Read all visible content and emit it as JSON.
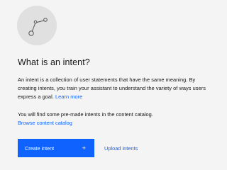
{
  "illustration": {
    "icon": "intent-nodes-icon",
    "circle_color": "#e0e0e0",
    "line_color": "#525252"
  },
  "heading": "What is an intent?",
  "description": {
    "text": "An intent is a collection of user statements that have the same meaning. By creating intents, you train your assistant to understand the variety of ways users express a goal.",
    "learn_more": "Learn more"
  },
  "catalog": {
    "text": "You will find some pre-made intents in the content catalog.",
    "link": "Browse content catalog"
  },
  "actions": {
    "create_label": "Create intent",
    "create_icon": "+",
    "upload_label": "Upload intents"
  },
  "colors": {
    "primary": "#0f62fe",
    "background": "#f4f4f4",
    "text": "#161616"
  }
}
